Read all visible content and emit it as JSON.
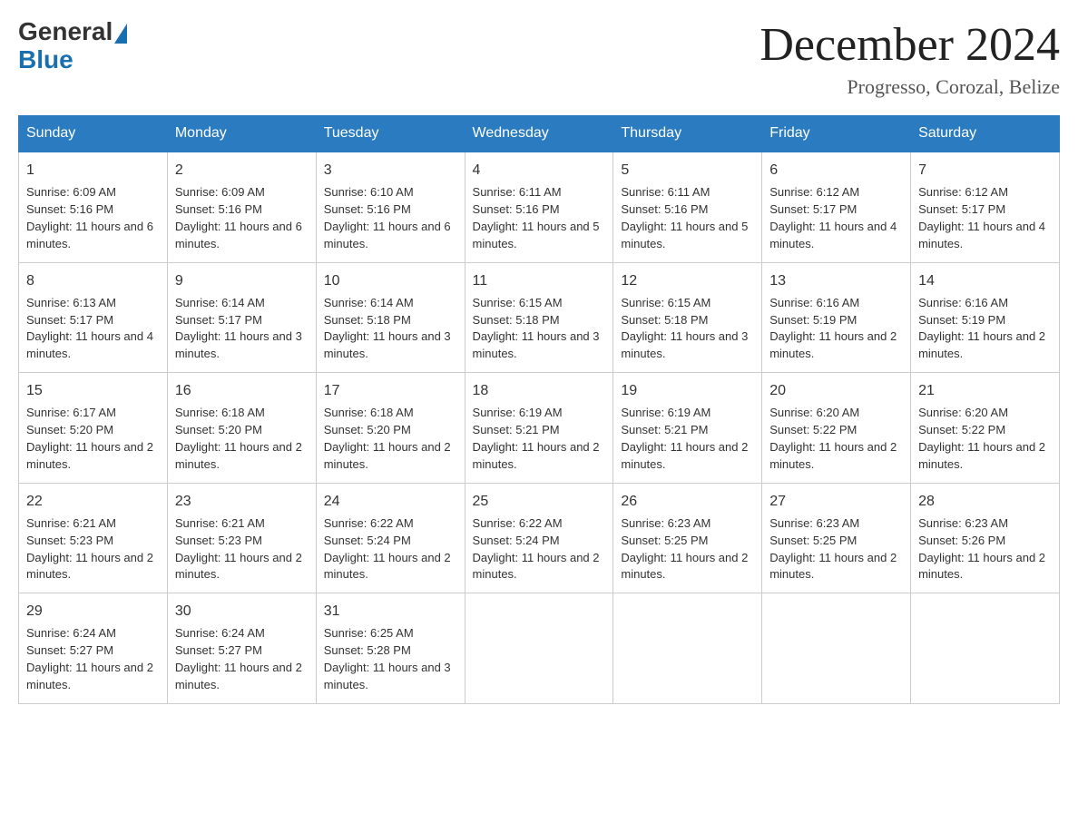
{
  "header": {
    "logo_general": "General",
    "logo_blue": "Blue",
    "month_title": "December 2024",
    "location": "Progresso, Corozal, Belize"
  },
  "weekdays": [
    "Sunday",
    "Monday",
    "Tuesday",
    "Wednesday",
    "Thursday",
    "Friday",
    "Saturday"
  ],
  "weeks": [
    [
      {
        "day": "1",
        "sunrise": "6:09 AM",
        "sunset": "5:16 PM",
        "daylight": "11 hours and 6 minutes."
      },
      {
        "day": "2",
        "sunrise": "6:09 AM",
        "sunset": "5:16 PM",
        "daylight": "11 hours and 6 minutes."
      },
      {
        "day": "3",
        "sunrise": "6:10 AM",
        "sunset": "5:16 PM",
        "daylight": "11 hours and 6 minutes."
      },
      {
        "day": "4",
        "sunrise": "6:11 AM",
        "sunset": "5:16 PM",
        "daylight": "11 hours and 5 minutes."
      },
      {
        "day": "5",
        "sunrise": "6:11 AM",
        "sunset": "5:16 PM",
        "daylight": "11 hours and 5 minutes."
      },
      {
        "day": "6",
        "sunrise": "6:12 AM",
        "sunset": "5:17 PM",
        "daylight": "11 hours and 4 minutes."
      },
      {
        "day": "7",
        "sunrise": "6:12 AM",
        "sunset": "5:17 PM",
        "daylight": "11 hours and 4 minutes."
      }
    ],
    [
      {
        "day": "8",
        "sunrise": "6:13 AM",
        "sunset": "5:17 PM",
        "daylight": "11 hours and 4 minutes."
      },
      {
        "day": "9",
        "sunrise": "6:14 AM",
        "sunset": "5:17 PM",
        "daylight": "11 hours and 3 minutes."
      },
      {
        "day": "10",
        "sunrise": "6:14 AM",
        "sunset": "5:18 PM",
        "daylight": "11 hours and 3 minutes."
      },
      {
        "day": "11",
        "sunrise": "6:15 AM",
        "sunset": "5:18 PM",
        "daylight": "11 hours and 3 minutes."
      },
      {
        "day": "12",
        "sunrise": "6:15 AM",
        "sunset": "5:18 PM",
        "daylight": "11 hours and 3 minutes."
      },
      {
        "day": "13",
        "sunrise": "6:16 AM",
        "sunset": "5:19 PM",
        "daylight": "11 hours and 2 minutes."
      },
      {
        "day": "14",
        "sunrise": "6:16 AM",
        "sunset": "5:19 PM",
        "daylight": "11 hours and 2 minutes."
      }
    ],
    [
      {
        "day": "15",
        "sunrise": "6:17 AM",
        "sunset": "5:20 PM",
        "daylight": "11 hours and 2 minutes."
      },
      {
        "day": "16",
        "sunrise": "6:18 AM",
        "sunset": "5:20 PM",
        "daylight": "11 hours and 2 minutes."
      },
      {
        "day": "17",
        "sunrise": "6:18 AM",
        "sunset": "5:20 PM",
        "daylight": "11 hours and 2 minutes."
      },
      {
        "day": "18",
        "sunrise": "6:19 AM",
        "sunset": "5:21 PM",
        "daylight": "11 hours and 2 minutes."
      },
      {
        "day": "19",
        "sunrise": "6:19 AM",
        "sunset": "5:21 PM",
        "daylight": "11 hours and 2 minutes."
      },
      {
        "day": "20",
        "sunrise": "6:20 AM",
        "sunset": "5:22 PM",
        "daylight": "11 hours and 2 minutes."
      },
      {
        "day": "21",
        "sunrise": "6:20 AM",
        "sunset": "5:22 PM",
        "daylight": "11 hours and 2 minutes."
      }
    ],
    [
      {
        "day": "22",
        "sunrise": "6:21 AM",
        "sunset": "5:23 PM",
        "daylight": "11 hours and 2 minutes."
      },
      {
        "day": "23",
        "sunrise": "6:21 AM",
        "sunset": "5:23 PM",
        "daylight": "11 hours and 2 minutes."
      },
      {
        "day": "24",
        "sunrise": "6:22 AM",
        "sunset": "5:24 PM",
        "daylight": "11 hours and 2 minutes."
      },
      {
        "day": "25",
        "sunrise": "6:22 AM",
        "sunset": "5:24 PM",
        "daylight": "11 hours and 2 minutes."
      },
      {
        "day": "26",
        "sunrise": "6:23 AM",
        "sunset": "5:25 PM",
        "daylight": "11 hours and 2 minutes."
      },
      {
        "day": "27",
        "sunrise": "6:23 AM",
        "sunset": "5:25 PM",
        "daylight": "11 hours and 2 minutes."
      },
      {
        "day": "28",
        "sunrise": "6:23 AM",
        "sunset": "5:26 PM",
        "daylight": "11 hours and 2 minutes."
      }
    ],
    [
      {
        "day": "29",
        "sunrise": "6:24 AM",
        "sunset": "5:27 PM",
        "daylight": "11 hours and 2 minutes."
      },
      {
        "day": "30",
        "sunrise": "6:24 AM",
        "sunset": "5:27 PM",
        "daylight": "11 hours and 2 minutes."
      },
      {
        "day": "31",
        "sunrise": "6:25 AM",
        "sunset": "5:28 PM",
        "daylight": "11 hours and 3 minutes."
      },
      null,
      null,
      null,
      null
    ]
  ]
}
